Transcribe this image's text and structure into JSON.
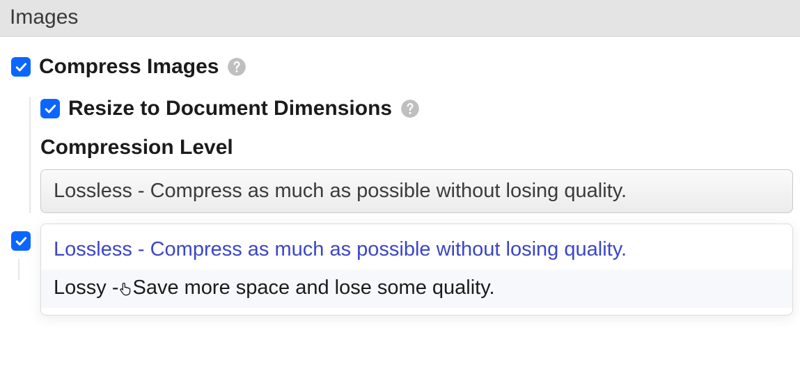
{
  "section": {
    "title": "Images"
  },
  "compress": {
    "label": "Compress Images",
    "checked": true
  },
  "resize": {
    "label": "Resize to Document Dimensions",
    "checked": true
  },
  "compressionLevel": {
    "label": "Compression Level",
    "selected": "Lossless - Compress as much as possible without losing quality.",
    "options": [
      "Lossless - Compress as much as possible without losing quality.",
      "Lossy - Save more space and lose some quality."
    ],
    "option_lossy_part1": "Lossy -",
    "option_lossy_part2": "Save more space and lose some quality."
  },
  "nextSetting": {
    "checked": true
  }
}
